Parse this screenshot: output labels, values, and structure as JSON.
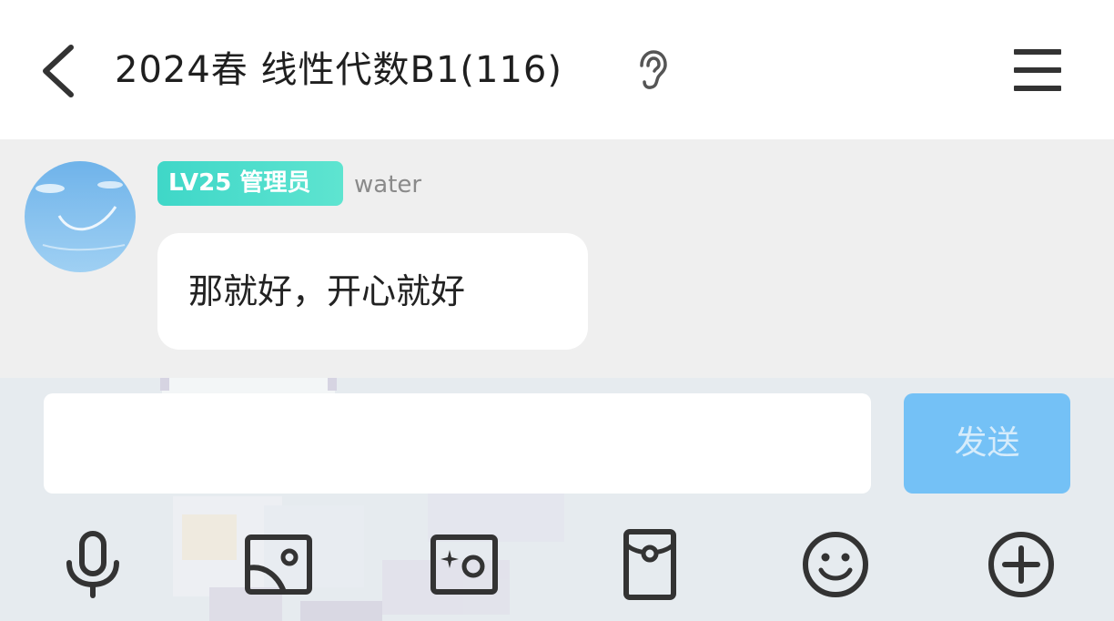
{
  "header": {
    "title": "2024春  线性代数B1(116)",
    "icons": {
      "back": "chevron-left-icon",
      "ear": "ear-icon",
      "menu": "hamburger-menu-icon"
    }
  },
  "message": {
    "badge": "LV25 管理员",
    "username": "water",
    "text": "那就好，开心就好"
  },
  "composer": {
    "input_value": "",
    "input_placeholder": "",
    "send_label": "发送"
  },
  "toolbar": [
    {
      "icon": "microphone-icon"
    },
    {
      "icon": "image-icon"
    },
    {
      "icon": "camera-icon"
    },
    {
      "icon": "red-packet-icon"
    },
    {
      "icon": "emoji-icon"
    },
    {
      "icon": "plus-icon"
    }
  ],
  "colors": {
    "badge": "#3fd7c8",
    "send_button": "#74c1f6",
    "chat_background": "#efefef",
    "composer_background": "#e6ebef"
  }
}
